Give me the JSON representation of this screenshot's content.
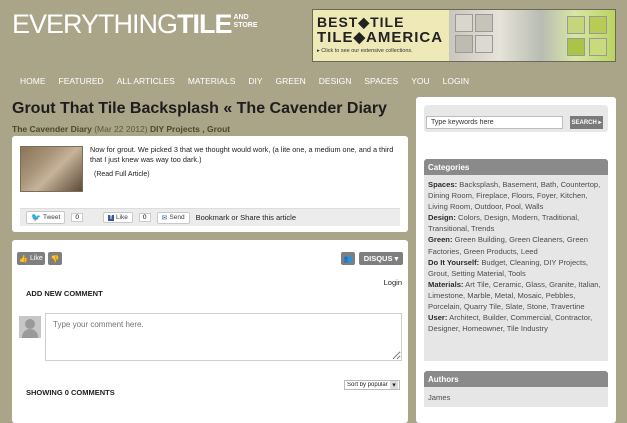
{
  "header": {
    "logo_main": "EVERYTHING",
    "logo_bold": "TILE",
    "logo_side_top": "AND",
    "logo_side_bottom": "STORE",
    "ad": {
      "line1": "BEST◆TILE",
      "line2": "TILE◆AMERICA",
      "cta": "▸ Click to see our extensive collections."
    }
  },
  "nav": [
    "HOME",
    "FEATURED",
    "ALL ARTICLES",
    "MATERIALS",
    "DIY",
    "GREEN",
    "DESIGN",
    "SPACES",
    "YOU",
    "LOGIN"
  ],
  "post": {
    "title": "Grout That Tile Backsplash « The Cavender Diary",
    "author": "The Cavender Diary",
    "date": "(Mar 22 2012)",
    "categories": "DIY Projects , Grout",
    "excerpt": "Now for grout. We picked 3 that we thought would work, (a lite one, a medium one, and a third that I just knew was way too dark.)",
    "read_more": "(Read Full Article)",
    "share": {
      "tweet": "Tweet",
      "tweet_count": "0",
      "like": "Like",
      "like_count": "0",
      "send": "Send",
      "bookmark_label": "Bookmark or Share this article"
    }
  },
  "disqus": {
    "like": "Like",
    "brand": "DISQUS",
    "login": "Login",
    "add_comment": "ADD NEW COMMENT",
    "placeholder": "Type your comment here.",
    "showing": "SHOWING 0 COMMENTS",
    "sort": "Sort by popular"
  },
  "sidebar": {
    "search_placeholder": "Type keywords here",
    "search_button": "SEARCH ▸",
    "categories_title": "Categories",
    "categories": [
      {
        "label": "Spaces:",
        "items": "Backsplash, Basement, Bath, Countertop, Dining Room, Fireplace, Floors, Foyer, Kitchen, Living Room, Outdoor, Pool, Walls"
      },
      {
        "label": "Design:",
        "items": "Colors, Design, Modern, Traditional, Transitional, Trends"
      },
      {
        "label": "Green:",
        "items": "Green Building, Green Cleaners, Green Factories, Green Products, Leed"
      },
      {
        "label": "Do It Yourself:",
        "items": "Budget, Cleaning, DIY Projects, Grout, Setting Material, Tools"
      },
      {
        "label": "Materials:",
        "items": "Art Tile, Ceramic, Glass, Granite, Italian, Limestone, Marble, Metal, Mosaic, Pebbles, Porcelain, Quarry Tile, Slate, Stone, Travertine"
      },
      {
        "label": "User:",
        "items": "Architect, Builder, Commercial, Contractor, Designer, Homeowner, Tile Industry"
      }
    ],
    "authors_title": "Authors",
    "authors": [
      "James"
    ]
  }
}
